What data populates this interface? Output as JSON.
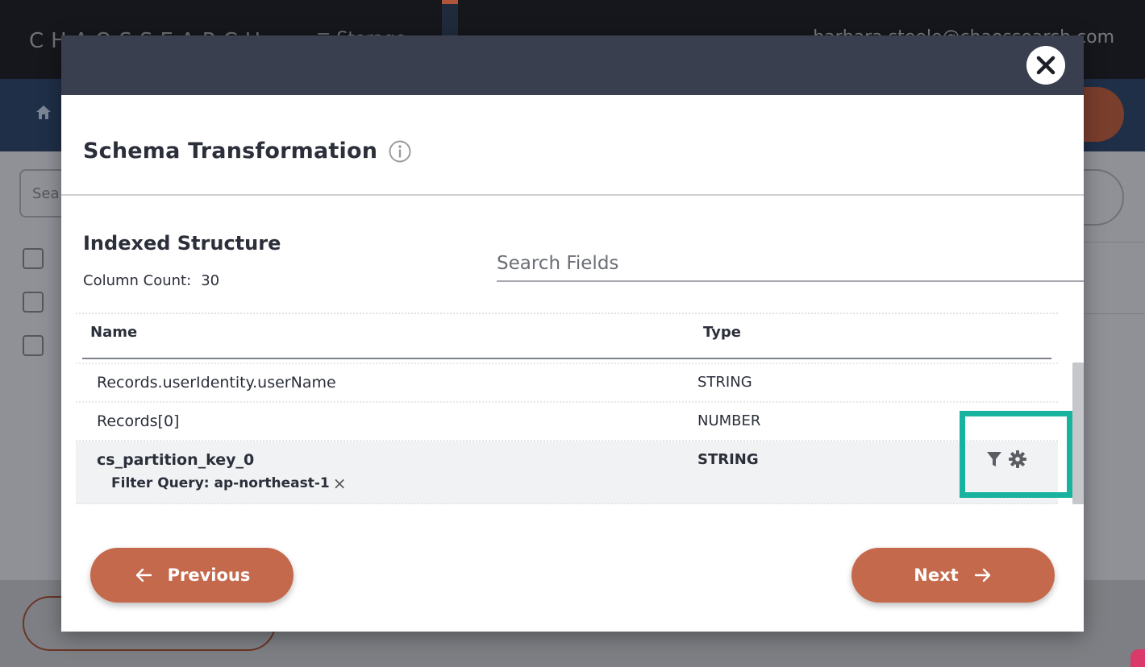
{
  "background": {
    "logo": "CHAOSSEARCH",
    "storage_label": "Storage",
    "user_email": "barbara.steele@chaossearch.com",
    "search_placeholder": "Sea"
  },
  "modal": {
    "title": "Schema Transformation",
    "section_title": "Indexed Structure",
    "column_count_label": "Column Count:",
    "column_count_value": "30",
    "search_placeholder": "Search Fields",
    "table": {
      "headers": {
        "name": "Name",
        "type": "Type"
      },
      "rows": [
        {
          "name": "Records.userIdentity.userName",
          "type": "STRING"
        },
        {
          "name": "Records[0]",
          "type": "NUMBER"
        },
        {
          "name": "cs_partition_key_0",
          "type": "STRING",
          "filter_query": "Filter Query: ap-northeast-1"
        }
      ]
    },
    "previous_label": "Previous",
    "next_label": "Next"
  },
  "colors": {
    "accent": "#c5694c",
    "highlight": "#17b39e",
    "header": "#3a3f4f"
  }
}
